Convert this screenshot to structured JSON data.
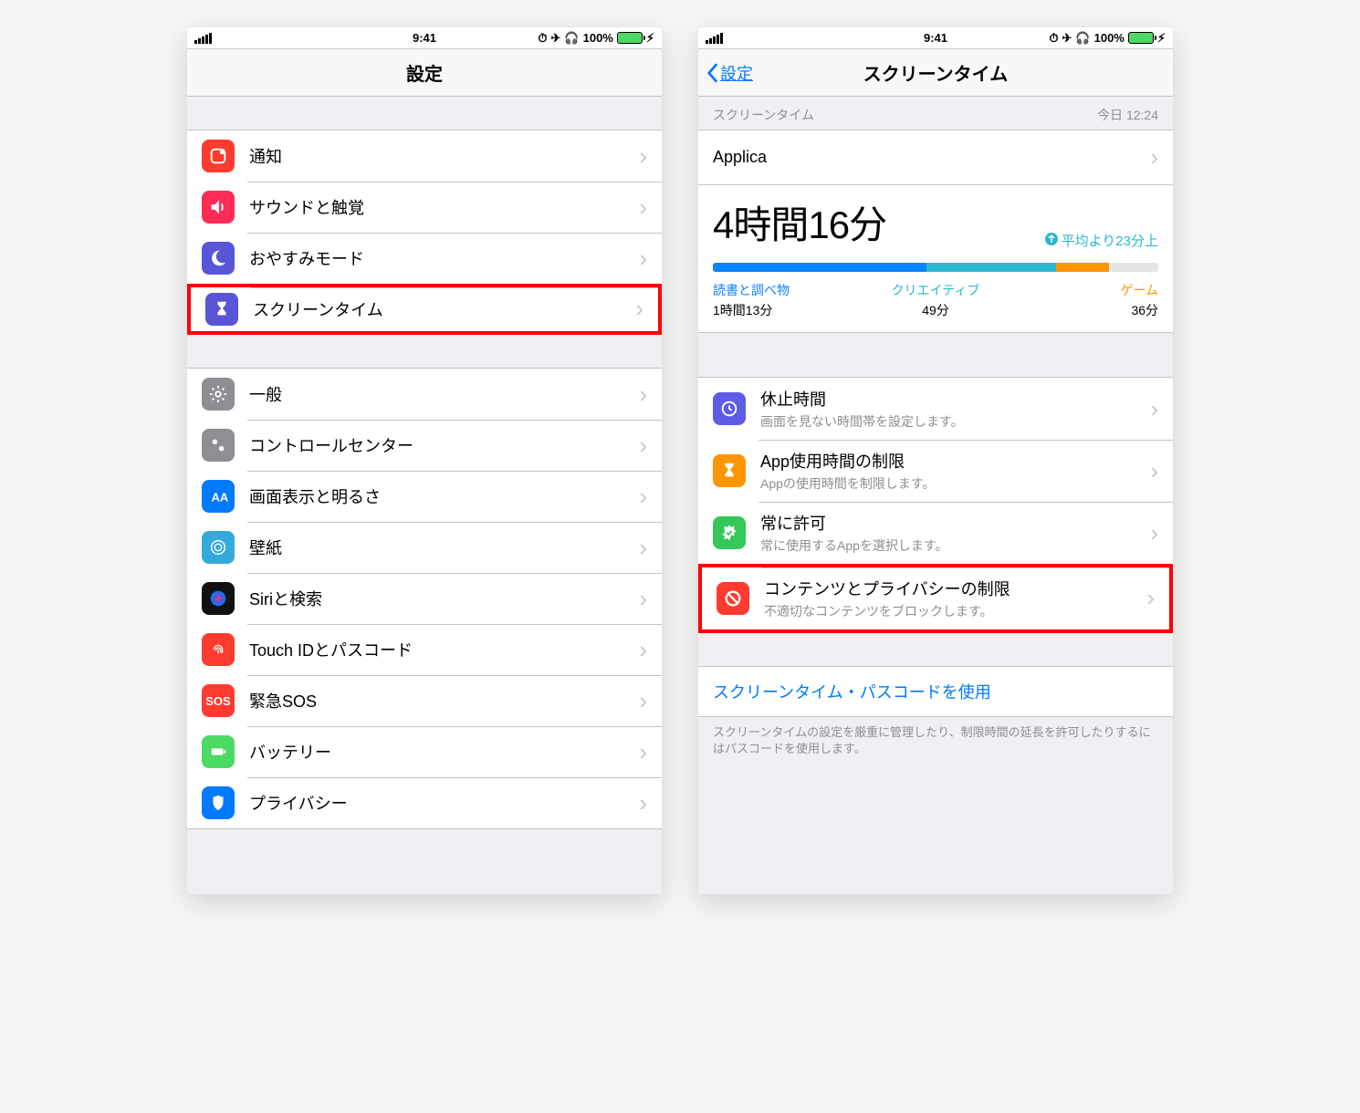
{
  "status": {
    "time": "9:41",
    "battery": "100%"
  },
  "left": {
    "nav_title": "設定",
    "group1": [
      {
        "icon": "notification",
        "color": "#ff3b30",
        "label": "通知"
      },
      {
        "icon": "sound",
        "color": "#ff2d55",
        "label": "サウンドと触覚"
      },
      {
        "icon": "moon",
        "color": "#5856d6",
        "label": "おやすみモード"
      },
      {
        "icon": "hourglass",
        "color": "#5856d6",
        "label": "スクリーンタイム",
        "highlight": true
      }
    ],
    "group2": [
      {
        "icon": "gear",
        "color": "#8e8e93",
        "label": "一般"
      },
      {
        "icon": "control",
        "color": "#8e8e93",
        "label": "コントロールセンター"
      },
      {
        "icon": "display",
        "color": "#007aff",
        "label": "画面表示と明るさ"
      },
      {
        "icon": "wallpaper",
        "color": "#34aadc",
        "label": "壁紙"
      },
      {
        "icon": "siri",
        "color": "#111",
        "label": "Siriと検索"
      },
      {
        "icon": "touchid",
        "color": "#ff3b30",
        "label": "Touch IDとパスコード"
      },
      {
        "icon": "sos",
        "color": "#ff3b30",
        "label": "緊急SOS",
        "text_icon": "SOS"
      },
      {
        "icon": "battery",
        "color": "#4cd964",
        "label": "バッテリー"
      },
      {
        "icon": "privacy",
        "color": "#007aff",
        "label": "プライバシー"
      }
    ]
  },
  "right": {
    "nav_back": "設定",
    "nav_title": "スクリーンタイム",
    "header_left": "スクリーンタイム",
    "header_right": "今日 12:24",
    "app_name": "Applica",
    "total_time": "4時間16分",
    "avg_text": "平均より23分上",
    "categories": [
      {
        "name": "読書と調べ物",
        "value": "1時間13分",
        "color": "c-blue",
        "bar": 48
      },
      {
        "name": "クリエイティブ",
        "value": "49分",
        "color": "c-teal",
        "bar": 29
      },
      {
        "name": "ゲーム",
        "value": "36分",
        "color": "c-orange",
        "bar": 12
      }
    ],
    "options": [
      {
        "icon": "clock",
        "color": "#5e5ce6",
        "title": "休止時間",
        "sub": "画面を見ない時間帯を設定します。"
      },
      {
        "icon": "hourglass",
        "color": "#ff9500",
        "title": "App使用時間の制限",
        "sub": "Appの使用時間を制限します。"
      },
      {
        "icon": "check",
        "color": "#34c759",
        "title": "常に許可",
        "sub": "常に使用するAppを選択します。"
      },
      {
        "icon": "block",
        "color": "#ff3b30",
        "title": "コンテンツとプライバシーの制限",
        "sub": "不適切なコンテンツをブロックします。",
        "highlight": true
      }
    ],
    "link": "スクリーンタイム・パスコードを使用",
    "footer": "スクリーンタイムの設定を厳重に管理したり、制限時間の延長を許可したりするにはパスコードを使用します。"
  }
}
